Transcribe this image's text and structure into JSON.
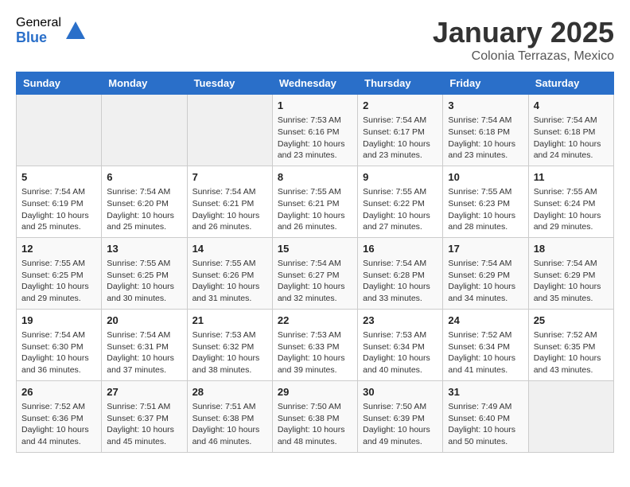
{
  "header": {
    "logo_general": "General",
    "logo_blue": "Blue",
    "month_title": "January 2025",
    "subtitle": "Colonia Terrazas, Mexico"
  },
  "days_of_week": [
    "Sunday",
    "Monday",
    "Tuesday",
    "Wednesday",
    "Thursday",
    "Friday",
    "Saturday"
  ],
  "weeks": [
    [
      {
        "day": "",
        "info": ""
      },
      {
        "day": "",
        "info": ""
      },
      {
        "day": "",
        "info": ""
      },
      {
        "day": "1",
        "info": "Sunrise: 7:53 AM\nSunset: 6:16 PM\nDaylight: 10 hours\nand 23 minutes."
      },
      {
        "day": "2",
        "info": "Sunrise: 7:54 AM\nSunset: 6:17 PM\nDaylight: 10 hours\nand 23 minutes."
      },
      {
        "day": "3",
        "info": "Sunrise: 7:54 AM\nSunset: 6:18 PM\nDaylight: 10 hours\nand 23 minutes."
      },
      {
        "day": "4",
        "info": "Sunrise: 7:54 AM\nSunset: 6:18 PM\nDaylight: 10 hours\nand 24 minutes."
      }
    ],
    [
      {
        "day": "5",
        "info": "Sunrise: 7:54 AM\nSunset: 6:19 PM\nDaylight: 10 hours\nand 25 minutes."
      },
      {
        "day": "6",
        "info": "Sunrise: 7:54 AM\nSunset: 6:20 PM\nDaylight: 10 hours\nand 25 minutes."
      },
      {
        "day": "7",
        "info": "Sunrise: 7:54 AM\nSunset: 6:21 PM\nDaylight: 10 hours\nand 26 minutes."
      },
      {
        "day": "8",
        "info": "Sunrise: 7:55 AM\nSunset: 6:21 PM\nDaylight: 10 hours\nand 26 minutes."
      },
      {
        "day": "9",
        "info": "Sunrise: 7:55 AM\nSunset: 6:22 PM\nDaylight: 10 hours\nand 27 minutes."
      },
      {
        "day": "10",
        "info": "Sunrise: 7:55 AM\nSunset: 6:23 PM\nDaylight: 10 hours\nand 28 minutes."
      },
      {
        "day": "11",
        "info": "Sunrise: 7:55 AM\nSunset: 6:24 PM\nDaylight: 10 hours\nand 29 minutes."
      }
    ],
    [
      {
        "day": "12",
        "info": "Sunrise: 7:55 AM\nSunset: 6:25 PM\nDaylight: 10 hours\nand 29 minutes."
      },
      {
        "day": "13",
        "info": "Sunrise: 7:55 AM\nSunset: 6:25 PM\nDaylight: 10 hours\nand 30 minutes."
      },
      {
        "day": "14",
        "info": "Sunrise: 7:55 AM\nSunset: 6:26 PM\nDaylight: 10 hours\nand 31 minutes."
      },
      {
        "day": "15",
        "info": "Sunrise: 7:54 AM\nSunset: 6:27 PM\nDaylight: 10 hours\nand 32 minutes."
      },
      {
        "day": "16",
        "info": "Sunrise: 7:54 AM\nSunset: 6:28 PM\nDaylight: 10 hours\nand 33 minutes."
      },
      {
        "day": "17",
        "info": "Sunrise: 7:54 AM\nSunset: 6:29 PM\nDaylight: 10 hours\nand 34 minutes."
      },
      {
        "day": "18",
        "info": "Sunrise: 7:54 AM\nSunset: 6:29 PM\nDaylight: 10 hours\nand 35 minutes."
      }
    ],
    [
      {
        "day": "19",
        "info": "Sunrise: 7:54 AM\nSunset: 6:30 PM\nDaylight: 10 hours\nand 36 minutes."
      },
      {
        "day": "20",
        "info": "Sunrise: 7:54 AM\nSunset: 6:31 PM\nDaylight: 10 hours\nand 37 minutes."
      },
      {
        "day": "21",
        "info": "Sunrise: 7:53 AM\nSunset: 6:32 PM\nDaylight: 10 hours\nand 38 minutes."
      },
      {
        "day": "22",
        "info": "Sunrise: 7:53 AM\nSunset: 6:33 PM\nDaylight: 10 hours\nand 39 minutes."
      },
      {
        "day": "23",
        "info": "Sunrise: 7:53 AM\nSunset: 6:34 PM\nDaylight: 10 hours\nand 40 minutes."
      },
      {
        "day": "24",
        "info": "Sunrise: 7:52 AM\nSunset: 6:34 PM\nDaylight: 10 hours\nand 41 minutes."
      },
      {
        "day": "25",
        "info": "Sunrise: 7:52 AM\nSunset: 6:35 PM\nDaylight: 10 hours\nand 43 minutes."
      }
    ],
    [
      {
        "day": "26",
        "info": "Sunrise: 7:52 AM\nSunset: 6:36 PM\nDaylight: 10 hours\nand 44 minutes."
      },
      {
        "day": "27",
        "info": "Sunrise: 7:51 AM\nSunset: 6:37 PM\nDaylight: 10 hours\nand 45 minutes."
      },
      {
        "day": "28",
        "info": "Sunrise: 7:51 AM\nSunset: 6:38 PM\nDaylight: 10 hours\nand 46 minutes."
      },
      {
        "day": "29",
        "info": "Sunrise: 7:50 AM\nSunset: 6:38 PM\nDaylight: 10 hours\nand 48 minutes."
      },
      {
        "day": "30",
        "info": "Sunrise: 7:50 AM\nSunset: 6:39 PM\nDaylight: 10 hours\nand 49 minutes."
      },
      {
        "day": "31",
        "info": "Sunrise: 7:49 AM\nSunset: 6:40 PM\nDaylight: 10 hours\nand 50 minutes."
      },
      {
        "day": "",
        "info": ""
      }
    ]
  ]
}
